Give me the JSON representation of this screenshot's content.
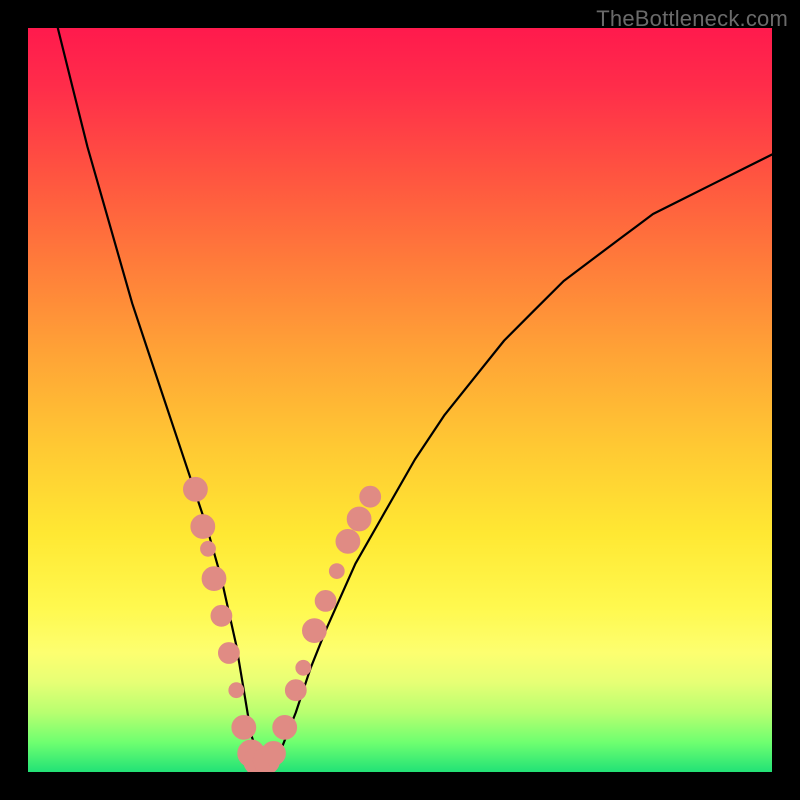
{
  "watermark": "TheBottleneck.com",
  "colors": {
    "frame": "#000000",
    "gradient_top": "#ff1a4d",
    "gradient_bottom": "#22e276",
    "curve": "#000000",
    "marker": "#e08b84",
    "watermark_text": "#6a6a6a"
  },
  "chart_data": {
    "type": "line",
    "title": "",
    "xlabel": "",
    "ylabel": "",
    "xlim": [
      0,
      100
    ],
    "ylim": [
      0,
      100
    ],
    "grid": false,
    "legend": false,
    "series": [
      {
        "name": "bottleneck-curve",
        "x": [
          4,
          6,
          8,
          10,
          12,
          14,
          16,
          18,
          20,
          22,
          24,
          26,
          28,
          29,
          30,
          31,
          32,
          34,
          36,
          38,
          40,
          44,
          48,
          52,
          56,
          60,
          64,
          68,
          72,
          76,
          80,
          84,
          88,
          92,
          96,
          100
        ],
        "values": [
          100,
          92,
          84,
          77,
          70,
          63,
          57,
          51,
          45,
          39,
          33,
          26,
          17,
          11,
          5,
          2,
          1,
          3,
          8,
          14,
          19,
          28,
          35,
          42,
          48,
          53,
          58,
          62,
          66,
          69,
          72,
          75,
          77,
          79,
          81,
          83
        ]
      }
    ],
    "markers": [
      {
        "x": 22.5,
        "y": 38,
        "r": 1.6
      },
      {
        "x": 23.5,
        "y": 33,
        "r": 1.6
      },
      {
        "x": 24.2,
        "y": 30,
        "r": 1.0
      },
      {
        "x": 25.0,
        "y": 26,
        "r": 1.6
      },
      {
        "x": 26.0,
        "y": 21,
        "r": 1.4
      },
      {
        "x": 27.0,
        "y": 16,
        "r": 1.4
      },
      {
        "x": 28.0,
        "y": 11,
        "r": 1.0
      },
      {
        "x": 29.0,
        "y": 6,
        "r": 1.6
      },
      {
        "x": 30.0,
        "y": 2.5,
        "r": 1.8
      },
      {
        "x": 31.0,
        "y": 1.5,
        "r": 2.0
      },
      {
        "x": 32.0,
        "y": 1.5,
        "r": 1.8
      },
      {
        "x": 33.0,
        "y": 2.5,
        "r": 1.6
      },
      {
        "x": 34.5,
        "y": 6,
        "r": 1.6
      },
      {
        "x": 36.0,
        "y": 11,
        "r": 1.4
      },
      {
        "x": 37.0,
        "y": 14,
        "r": 1.0
      },
      {
        "x": 38.5,
        "y": 19,
        "r": 1.6
      },
      {
        "x": 40.0,
        "y": 23,
        "r": 1.4
      },
      {
        "x": 41.5,
        "y": 27,
        "r": 1.0
      },
      {
        "x": 43.0,
        "y": 31,
        "r": 1.6
      },
      {
        "x": 44.5,
        "y": 34,
        "r": 1.6
      },
      {
        "x": 46.0,
        "y": 37,
        "r": 1.4
      }
    ],
    "annotations": []
  }
}
